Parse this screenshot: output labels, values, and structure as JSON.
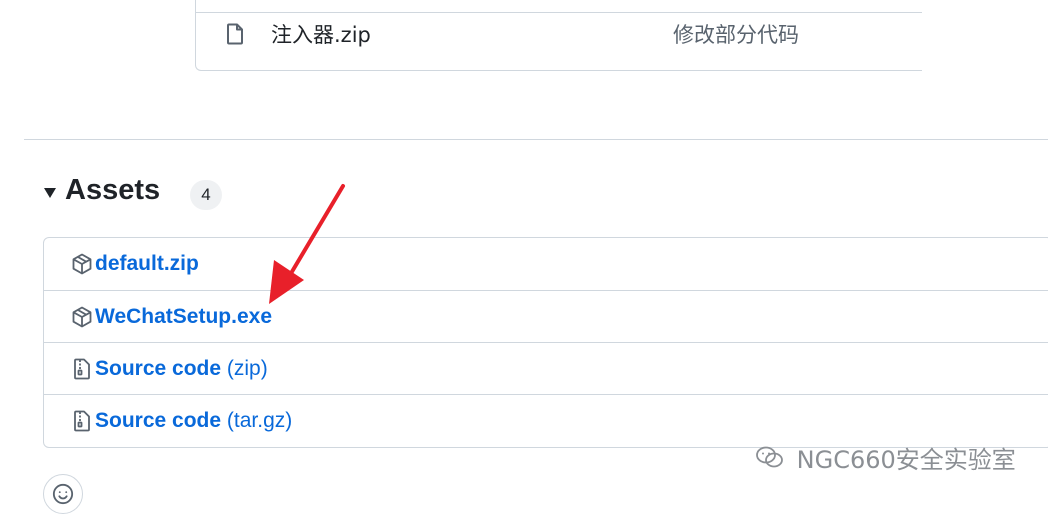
{
  "files": [
    {
      "name": "注入器.zip",
      "commit_message": "修改部分代码",
      "icon": "file-icon"
    }
  ],
  "assets": {
    "title": "Assets",
    "count": "4",
    "items": [
      {
        "name": "default.zip",
        "suffix": "",
        "icon": "package-icon"
      },
      {
        "name": "WeChatSetup.exe",
        "suffix": "",
        "icon": "package-icon"
      },
      {
        "name": "Source code",
        "suffix": "(zip)",
        "icon": "file-zip-icon"
      },
      {
        "name": "Source code",
        "suffix": "(tar.gz)",
        "icon": "file-zip-icon"
      }
    ]
  },
  "annotation": {
    "arrow_color": "#e8202a"
  },
  "watermark": {
    "text": "NGC660安全实验室"
  },
  "colors": {
    "link": "#0969da",
    "border": "#d0d7de",
    "text": "#1f2328",
    "muted": "#59636e"
  }
}
